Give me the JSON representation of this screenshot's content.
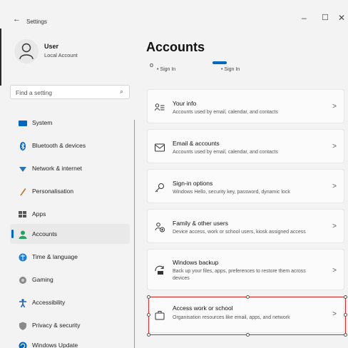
{
  "window": {
    "title": "Settings",
    "back_glyph": "←",
    "minimize_glyph": "–",
    "maximize_glyph": "☐",
    "close_glyph": "✕"
  },
  "profile": {
    "name": "User",
    "account_type": "Local Account"
  },
  "search": {
    "placeholder": "Find a setting",
    "icon": "search-icon"
  },
  "sidebar": {
    "items": [
      {
        "label": "System",
        "icon": "system-icon",
        "color": "#0067c0"
      },
      {
        "label": "Bluetooth & devices",
        "icon": "bluetooth-icon",
        "color": "#0067c0"
      },
      {
        "label": "Network & internet",
        "icon": "network-icon",
        "color": "#2f6fb5"
      },
      {
        "label": "Personalisation",
        "icon": "personalisation-icon",
        "color": "#c47a2c"
      },
      {
        "label": "Apps",
        "icon": "apps-icon",
        "color": "#555555"
      },
      {
        "label": "Accounts",
        "icon": "accounts-icon",
        "color": "#2aa160",
        "selected": true
      },
      {
        "label": "Time & language",
        "icon": "time-language-icon",
        "color": "#1a7fd1"
      },
      {
        "label": "Gaming",
        "icon": "gaming-icon",
        "color": "#777777"
      },
      {
        "label": "Accessibility",
        "icon": "accessibility-icon",
        "color": "#1a5fb4"
      },
      {
        "label": "Privacy & security",
        "icon": "privacy-icon",
        "color": "#7a7a7a"
      },
      {
        "label": "Windows Update",
        "icon": "windows-update-icon",
        "color": "#0067c0"
      }
    ]
  },
  "main": {
    "title": "Accounts",
    "signin_row": {
      "circle_glyph": "o",
      "item1": "• Sign In",
      "item2": "• Sign In"
    },
    "cards": [
      {
        "title": "Your info",
        "desc": "Accounts used by email, calendar, and contacts",
        "icon": "your-info-icon"
      },
      {
        "title": "Email & accounts",
        "desc": "Accounts used by email, calendar, and contacts",
        "icon": "email-icon"
      },
      {
        "title": "Sign-in options",
        "desc": "Windows Hello, security key, password, dynamic lock",
        "icon": "key-icon"
      },
      {
        "title": "Family & other users",
        "desc": "Device access, work or school users, kiosk assigned access",
        "icon": "family-icon"
      },
      {
        "title": "Windows backup",
        "desc": "Back up your files, apps, preferences to restore them across devices",
        "icon": "backup-icon"
      },
      {
        "title": "Access work or school",
        "desc": "Organisation resources like email, apps, and network",
        "icon": "briefcase-icon"
      }
    ],
    "chevron_glyph": ">"
  },
  "colors": {
    "accent": "#0067c0",
    "selection_box": "#d42a2a"
  }
}
